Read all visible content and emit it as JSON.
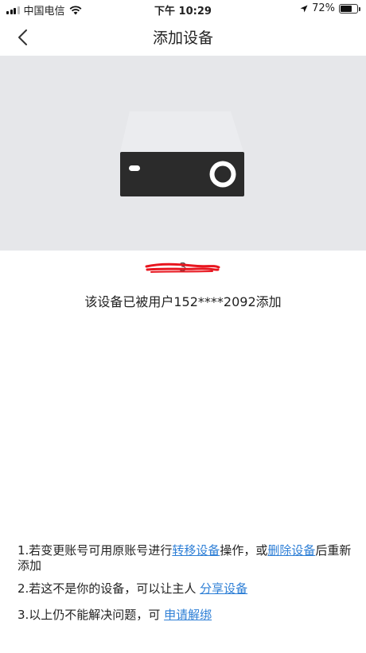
{
  "status_bar": {
    "carrier": "中国电信",
    "time": "下午 10:29",
    "battery_percent": "72%",
    "battery_level": 0.72
  },
  "nav": {
    "title": "添加设备"
  },
  "device": {
    "id_prefix": "3",
    "owner_text": "该设备已被用户152****2092添加"
  },
  "help": {
    "line1_a": "1.若变更账号可用原账号进行",
    "line1_link1": "转移设备",
    "line1_b": "操作，或",
    "line1_link2": "删除设备",
    "line1_c": "后重新添加",
    "line2_a": "2.若这不是你的设备，可以让主人 ",
    "line2_link": "分享设备",
    "line3_a": "3.以上仍不能解决问题，可 ",
    "line3_link": "申请解绑"
  },
  "colors": {
    "hero_bg": "#e6e7ea",
    "link": "#2e7fd6",
    "redaction": "#e8161f"
  }
}
